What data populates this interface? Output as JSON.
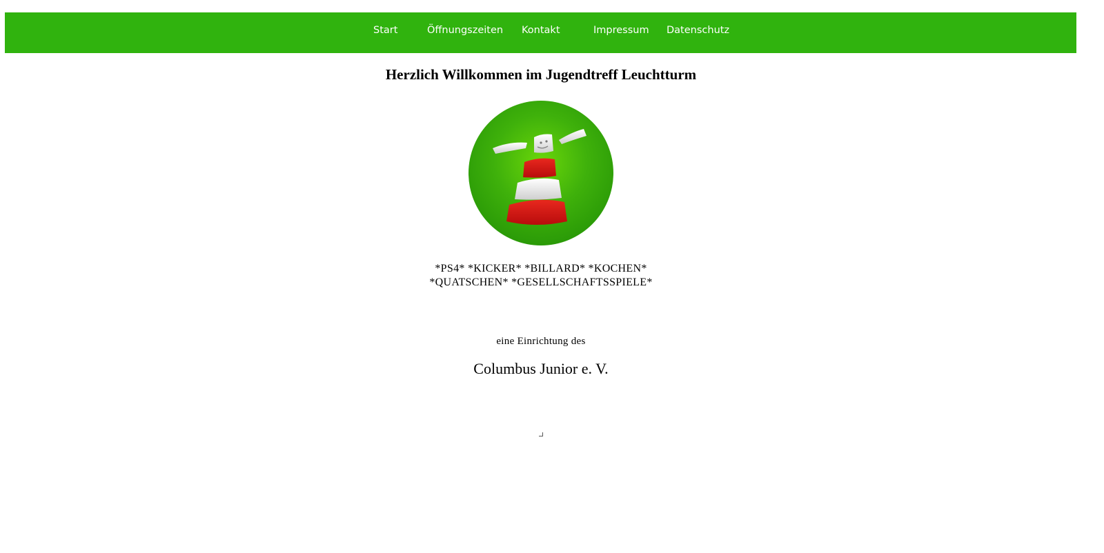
{
  "nav": {
    "items": [
      {
        "label": "Start"
      },
      {
        "label": "Öffnungszeiten"
      },
      {
        "label": "Kontakt"
      },
      {
        "label": "Impressum"
      },
      {
        "label": "Datenschutz"
      }
    ],
    "color": "#30b30e"
  },
  "main": {
    "title": "Herzlich Willkommen im Jugendtreff Leuchtturm",
    "logo_icon": "lighthouse-logo-icon",
    "activities_line1": "*PS4* *KICKER* *BILLARD* *KOCHEN*",
    "activities_line2": "*QUATSCHEN* *GESELLSCHAFTSSPIELE*",
    "operator_intro": "eine Einrichtung des",
    "operator_name": "Columbus Junior e. V."
  }
}
